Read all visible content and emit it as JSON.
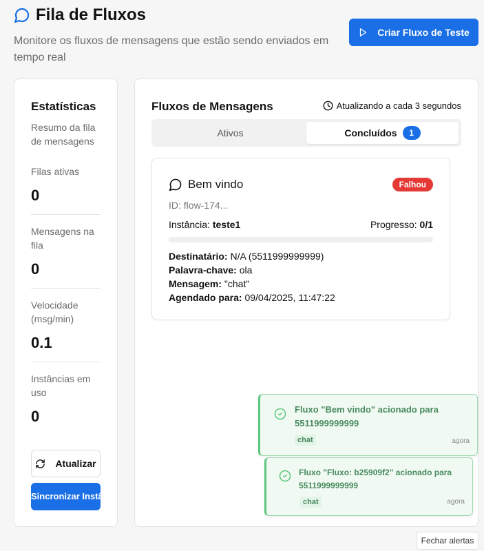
{
  "header": {
    "title": "Fila de Fluxos",
    "subtitle": "Monitore os fluxos de mensagens que estão sendo enviados em tempo real",
    "create_button": "Criar Fluxo de Teste"
  },
  "stats": {
    "title": "Estatísticas",
    "description": "Resumo da fila de mensagens",
    "items": [
      {
        "label": "Filas ativas",
        "value": "0"
      },
      {
        "label": "Mensagens na fila",
        "value": "0"
      },
      {
        "label": "Velocidade (msg/min)",
        "value": "0.1"
      },
      {
        "label": "Instâncias em uso",
        "value": "0"
      }
    ],
    "refresh_button": "Atualizar",
    "sync_button": "Sincronizar Instâncias"
  },
  "flows": {
    "title": "Fluxos de Mensagens",
    "updating_text": "Atualizando a cada 3 segundos",
    "tabs": [
      {
        "label": "Ativos"
      },
      {
        "label": "Concluídos",
        "count": "1"
      }
    ],
    "card": {
      "title": "Bem vindo",
      "status": "Falhou",
      "id": "ID: flow-174...",
      "instance_label": "Instância:",
      "instance_value": "teste1",
      "progress_label": "Progresso:",
      "progress_value": "0/1",
      "progress_fraction": 0,
      "recipient_label": "Destinatário:",
      "recipient_value": "N/A (5511999999999)",
      "keyword_label": "Palavra-chave:",
      "keyword_value": "ola",
      "message_label": "Mensagem:",
      "message_value": "\"chat\"",
      "scheduled_label": "Agendado para:",
      "scheduled_value": "09/04/2025, 11:47:22"
    }
  },
  "toasts": [
    {
      "message": "Fluxo \"Bem vindo\" acionado para 5511999999999",
      "tag": "chat",
      "time": "agora"
    },
    {
      "message": "Fluxo \"Fluxo: b25909f2\" acionado para 5511999999999",
      "tag": "chat",
      "time": "agora"
    }
  ],
  "close_alerts_button": "Fechar alertas",
  "colors": {
    "primary": "#1a6ee6",
    "danger": "#e53935",
    "success": "#5cc77c"
  }
}
